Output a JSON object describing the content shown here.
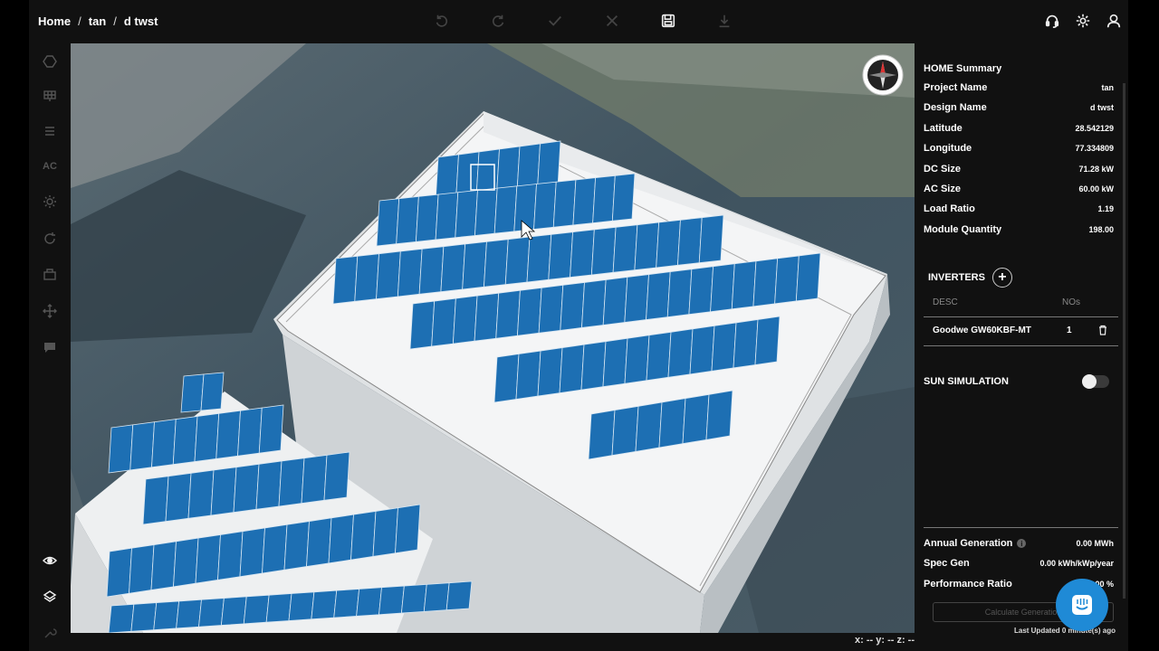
{
  "breadcrumb": {
    "home": "Home",
    "project": "tan",
    "design": "d twst",
    "separator": "/"
  },
  "toolbar": {
    "icons": [
      "undo-icon",
      "redo-icon",
      "check-icon",
      "close-icon",
      "save-icon",
      "download-icon",
      "headset-icon",
      "settings-icon",
      "user-icon"
    ]
  },
  "left_tools": {
    "ac_label": "AC",
    "icons": [
      "polygon-icon",
      "panel-grid-icon",
      "stack-icon",
      "ac-label",
      "sun-icon",
      "rotate-icon",
      "inverter-icon",
      "move-icon",
      "comment-icon",
      "eye-icon",
      "layers-icon",
      "wrench-icon"
    ]
  },
  "summary": {
    "title": "HOME Summary",
    "rows": [
      {
        "label": "Project Name",
        "value": "tan"
      },
      {
        "label": "Design Name",
        "value": "d twst"
      },
      {
        "label": "Latitude",
        "value": "28.542129"
      },
      {
        "label": "Longitude",
        "value": "77.334809"
      },
      {
        "label": "DC Size",
        "value": "71.28 kW"
      },
      {
        "label": "AC Size",
        "value": "60.00 kW"
      },
      {
        "label": "Load Ratio",
        "value": "1.19"
      },
      {
        "label": "Module Quantity",
        "value": "198.00"
      }
    ]
  },
  "inverters": {
    "title": "INVERTERS",
    "col_desc": "DESC",
    "col_nos": "NOs",
    "items": [
      {
        "desc": "Goodwe GW60KBF-MT",
        "nos": "1"
      }
    ]
  },
  "sun_simulation": {
    "label": "SUN SIMULATION",
    "on": false
  },
  "generation": {
    "annual_label": "Annual Generation",
    "annual_value": "0.00 MWh",
    "spec_label": "Spec Gen",
    "spec_value": "0.00 kWh/kWp/year",
    "perf_label": "Performance Ratio",
    "perf_value": "0.00 %",
    "calc_button": "Calculate Generation",
    "last_updated": "Last Updated 0 minute(s) ago"
  },
  "coords": "x: -- y: -- z: --",
  "colors": {
    "panel_blue": "#1d6fb3",
    "accent_blue": "#1f8ad6",
    "roof": "#f4f5f6"
  }
}
